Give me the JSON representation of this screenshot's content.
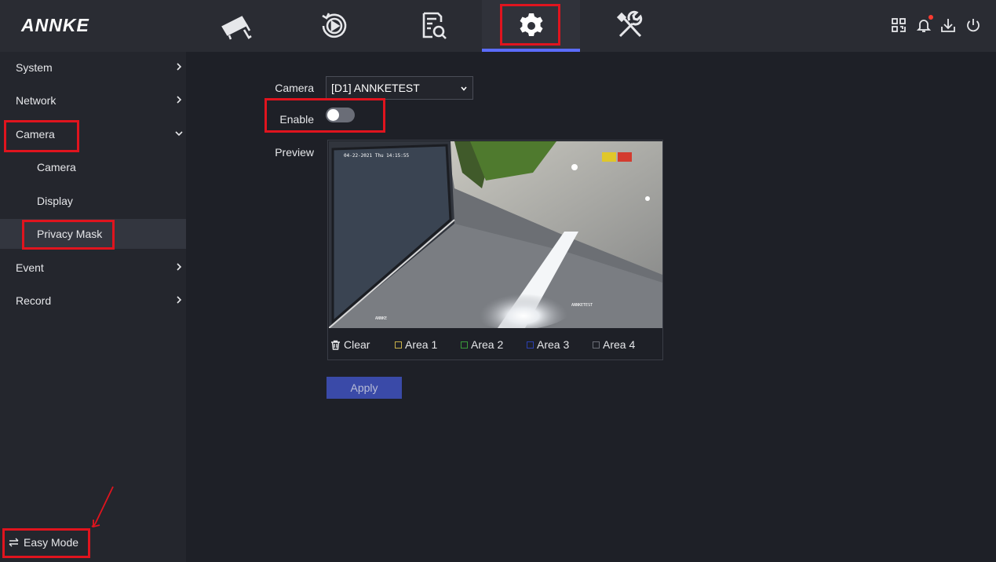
{
  "brand": {
    "logo": "ANNKE"
  },
  "topnav": {
    "tabs": [
      {
        "name": "live-view",
        "icon": "cctv-camera-icon"
      },
      {
        "name": "playback",
        "icon": "playback-icon"
      },
      {
        "name": "search",
        "icon": "file-search-icon"
      },
      {
        "name": "configuration",
        "icon": "gear-icon",
        "active": true
      },
      {
        "name": "maintenance",
        "icon": "tools-icon"
      }
    ],
    "right_icons": [
      "qr-code-icon",
      "bell-icon",
      "download-icon",
      "power-icon"
    ]
  },
  "sidebar": {
    "items": [
      {
        "label": "System"
      },
      {
        "label": "Network"
      },
      {
        "label": "Camera"
      },
      {
        "label": "Camera"
      },
      {
        "label": "Display"
      },
      {
        "label": "Privacy Mask"
      },
      {
        "label": "Event"
      },
      {
        "label": "Record"
      }
    ],
    "easy_mode": "Easy Mode"
  },
  "form": {
    "camera_label": "Camera",
    "camera_value": "[D1] ANNKETEST",
    "enable_label": "Enable",
    "enable_on": false,
    "preview_label": "Preview"
  },
  "preview": {
    "osd_time": "04-22-2021 Thu 14:15:55",
    "osd_name": "ANNKETEST",
    "osd_brand": "ANNKE"
  },
  "toolbar": {
    "clear": "Clear",
    "areas": [
      {
        "label": "Area 1",
        "color": "#c9b14a"
      },
      {
        "label": "Area 2",
        "color": "#3a9a3a"
      },
      {
        "label": "Area 3",
        "color": "#2a3fb0"
      },
      {
        "label": "Area 4",
        "color": "#6b6e76"
      }
    ]
  },
  "apply": "Apply",
  "colors": {
    "accent": "#5b6cff",
    "annotation": "#e0141e",
    "apply": "#3a4aa8"
  }
}
